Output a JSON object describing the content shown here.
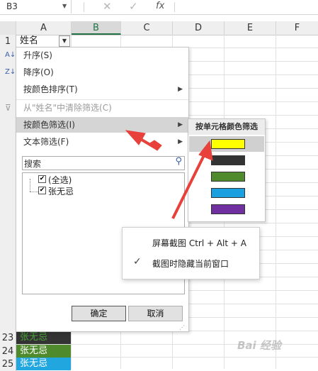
{
  "formula_bar": {
    "name_box": "B3",
    "fx": "fx",
    "cancel_icon": "x-icon",
    "enter_icon": "check-icon"
  },
  "columns": [
    "A",
    "B",
    "C",
    "D",
    "E",
    "F"
  ],
  "selected_column": "B",
  "row1": {
    "number": "1",
    "header_cell": "姓名"
  },
  "bottom_rows": [
    {
      "number": "23",
      "value": "张无忌",
      "fill": "#333333",
      "text_color": "#4da33a"
    },
    {
      "number": "24",
      "value": "张无忌",
      "fill": "#4f8a2c",
      "text_color": "#ffffff"
    },
    {
      "number": "25",
      "value": "张无忌",
      "fill": "#22a6e0",
      "text_color": "#ffffff"
    }
  ],
  "filter_menu": {
    "sort_asc": "升序(S)",
    "sort_desc": "降序(O)",
    "sort_by_color": "按颜色排序(T)",
    "clear_filter": "从\"姓名\"中清除筛选(C)",
    "filter_by_color": "按颜色筛选(I)",
    "text_filter": "文本筛选(F)",
    "search_placeholder": "搜索",
    "list_items": [
      "(全选)",
      "张无忌"
    ],
    "ok_label": "确定",
    "cancel_label": "取消"
  },
  "color_submenu": {
    "title": "按单元格颜色筛选",
    "swatches": [
      "#ffff00",
      "#333333",
      "#4f8a2c",
      "#1aa0e0",
      "#7030a0"
    ]
  },
  "screenshot_popup": {
    "item1": "屏幕截图 Ctrl + Alt + A",
    "item2": "截图时隐藏当前窗口"
  },
  "watermark": "Bai 经验",
  "annotation_color": "#e8403a"
}
